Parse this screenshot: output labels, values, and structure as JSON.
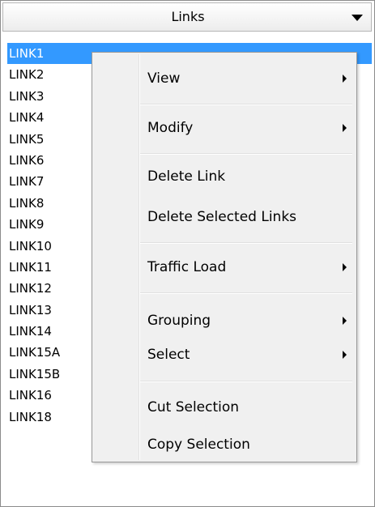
{
  "header": {
    "title": "Links",
    "dropdown_icon": "dropdown-arrow-icon"
  },
  "list": {
    "selected_index": 0,
    "items": [
      "LINK1",
      "LINK2",
      "LINK3",
      "LINK4",
      "LINK5",
      "LINK6",
      "LINK7",
      "LINK8",
      "LINK9",
      "LINK10",
      "LINK11",
      "LINK12",
      "LINK13",
      "LINK14",
      "LINK15A",
      "LINK15B",
      "LINK16",
      "LINK18"
    ]
  },
  "context_menu": {
    "items": [
      {
        "label": "View",
        "submenu": true
      },
      {
        "label": "Modify",
        "submenu": true
      },
      {
        "label": "Delete Link",
        "submenu": false
      },
      {
        "label": "Delete Selected Links",
        "submenu": false
      },
      {
        "label": "Traffic Load",
        "submenu": true
      },
      {
        "label": "Grouping",
        "submenu": true
      },
      {
        "label": "Select",
        "submenu": true
      },
      {
        "label": "Cut Selection",
        "submenu": false
      },
      {
        "label": "Copy Selection",
        "submenu": false
      }
    ]
  },
  "colors": {
    "selection": "#3399ff",
    "menu_background": "#f0f0f0"
  }
}
